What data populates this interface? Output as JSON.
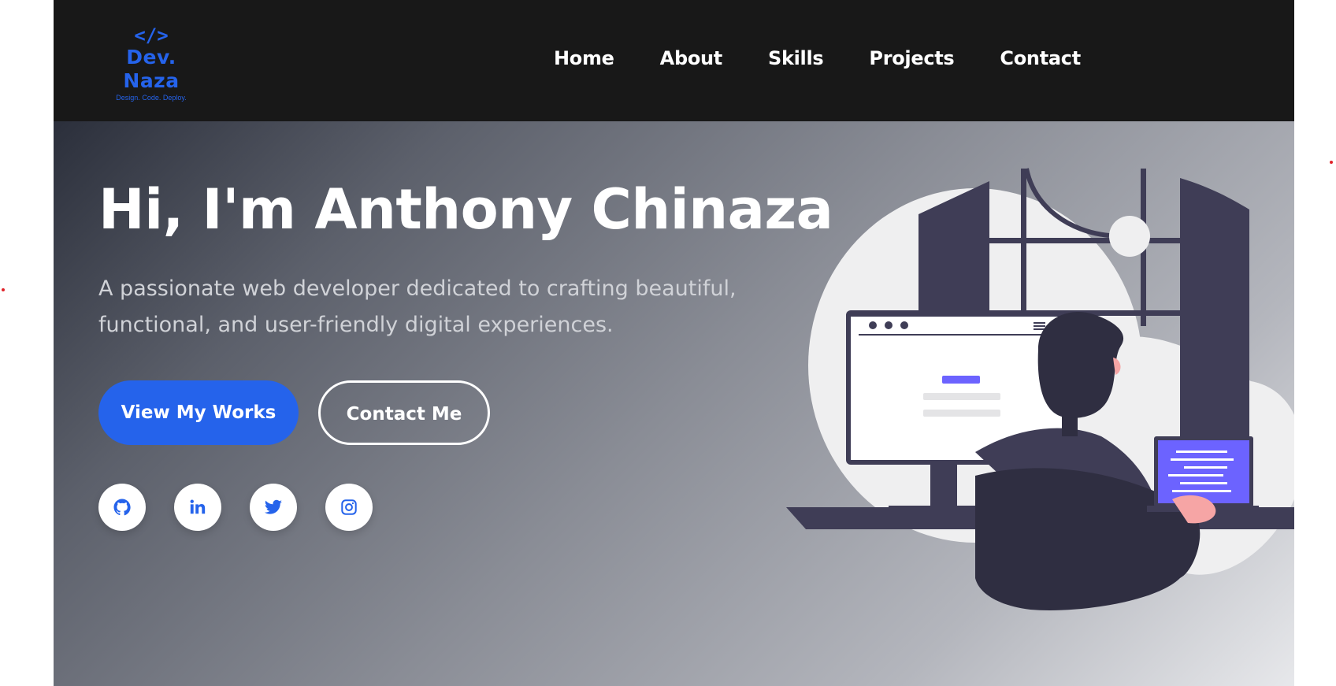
{
  "brand": {
    "icon_glyph": "</>",
    "name": "Dev. Naza",
    "tagline": "Design. Code. Deploy.",
    "color": "#2563eb"
  },
  "nav": {
    "items": [
      {
        "label": "Home"
      },
      {
        "label": "About"
      },
      {
        "label": "Skills"
      },
      {
        "label": "Projects"
      },
      {
        "label": "Contact"
      }
    ]
  },
  "hero": {
    "title": "Hi, I'm Anthony Chinaza",
    "subtitle": "A passionate web developer dedicated to crafting beautiful, functional, and user-friendly digital experiences.",
    "primary_button": "View My Works",
    "secondary_button": "Contact Me"
  },
  "social": [
    {
      "icon": "github-icon"
    },
    {
      "icon": "linkedin-icon"
    },
    {
      "icon": "twitter-icon"
    },
    {
      "icon": "instagram-icon"
    }
  ],
  "colors": {
    "navbar_bg": "#181818",
    "accent": "#2563eb",
    "illustration_purple": "#6c63ff",
    "illustration_dark": "#3f3d56"
  }
}
